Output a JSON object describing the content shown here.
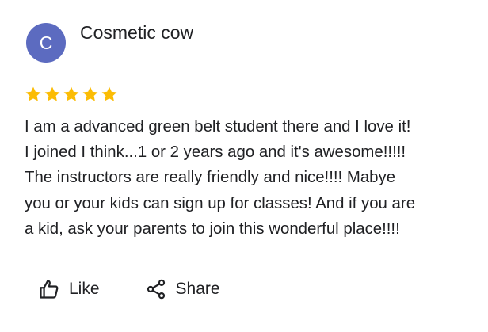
{
  "review": {
    "author": {
      "initial": "C",
      "name": "Cosmetic cow",
      "avatar_color": "#5c6bc0"
    },
    "rating": {
      "stars": 5,
      "max": 5,
      "star_color": "#fbbc04"
    },
    "text_lines": [
      "I am a advanced green belt student there and I love it!",
      "I joined I think...1 or 2 years ago and it's awesome!!!!!",
      "The instructors are really friendly and nice!!!! Mabye",
      "you or your kids can sign up for classes! And if you are",
      "a kid, ask your parents to join this wonderful place!!!!"
    ]
  },
  "actions": {
    "like": {
      "label": "Like",
      "icon": "thumb-up-icon"
    },
    "share": {
      "label": "Share",
      "icon": "share-icon"
    }
  }
}
